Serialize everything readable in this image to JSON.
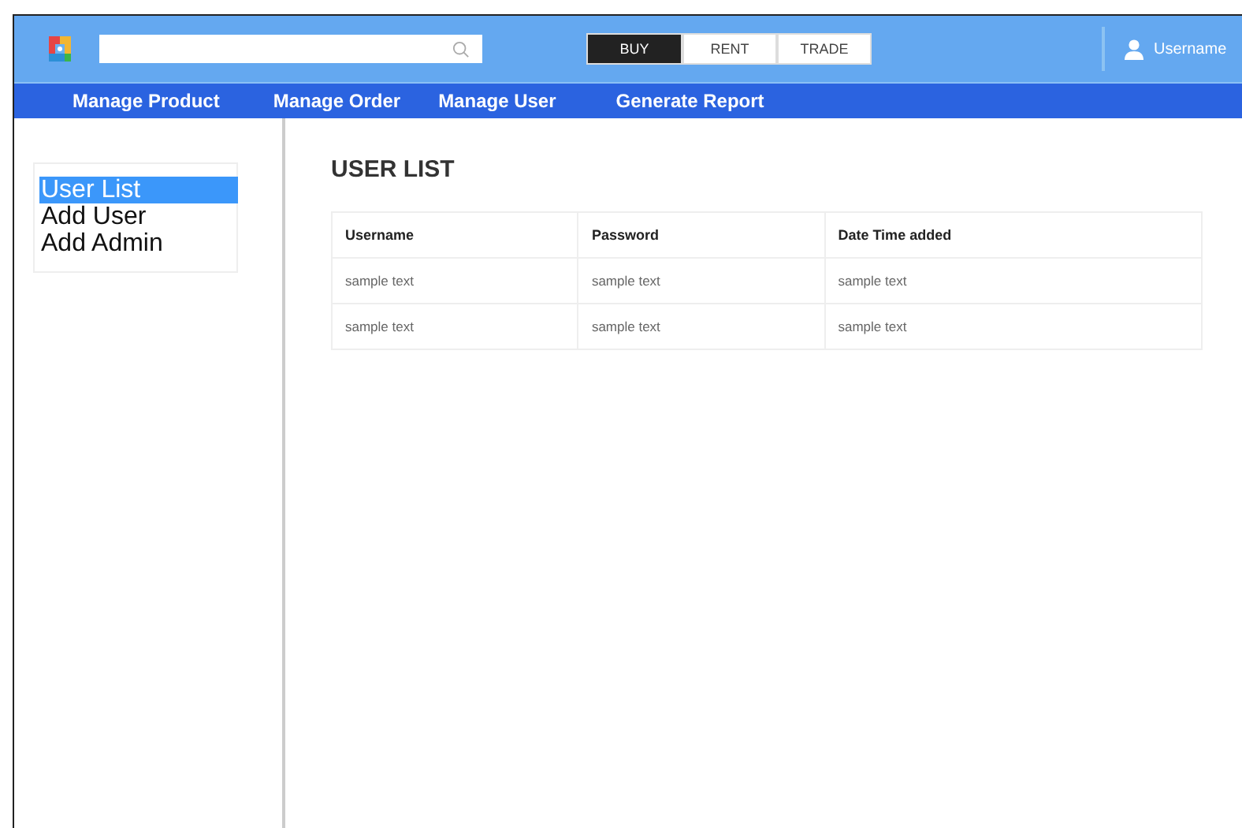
{
  "modes": [
    {
      "label": "BUY",
      "selected": true
    },
    {
      "label": "RENT",
      "selected": false
    },
    {
      "label": "TRADE",
      "selected": false
    }
  ],
  "user": {
    "name": "Username"
  },
  "nav": [
    "Manage Product",
    "Manage Order",
    "Manage User",
    "Generate Report"
  ],
  "sidebar": {
    "items": [
      {
        "label": "User List",
        "selected": true
      },
      {
        "label": "Add User",
        "selected": false
      },
      {
        "label": "Add Admin",
        "selected": false
      }
    ]
  },
  "page_title": "USER LIST",
  "table": {
    "columns": [
      "Username",
      "Password",
      "Date Time added"
    ],
    "rows": [
      [
        "sample text",
        "sample text",
        "sample text"
      ],
      [
        "sample text",
        "sample text",
        "sample text"
      ]
    ]
  }
}
